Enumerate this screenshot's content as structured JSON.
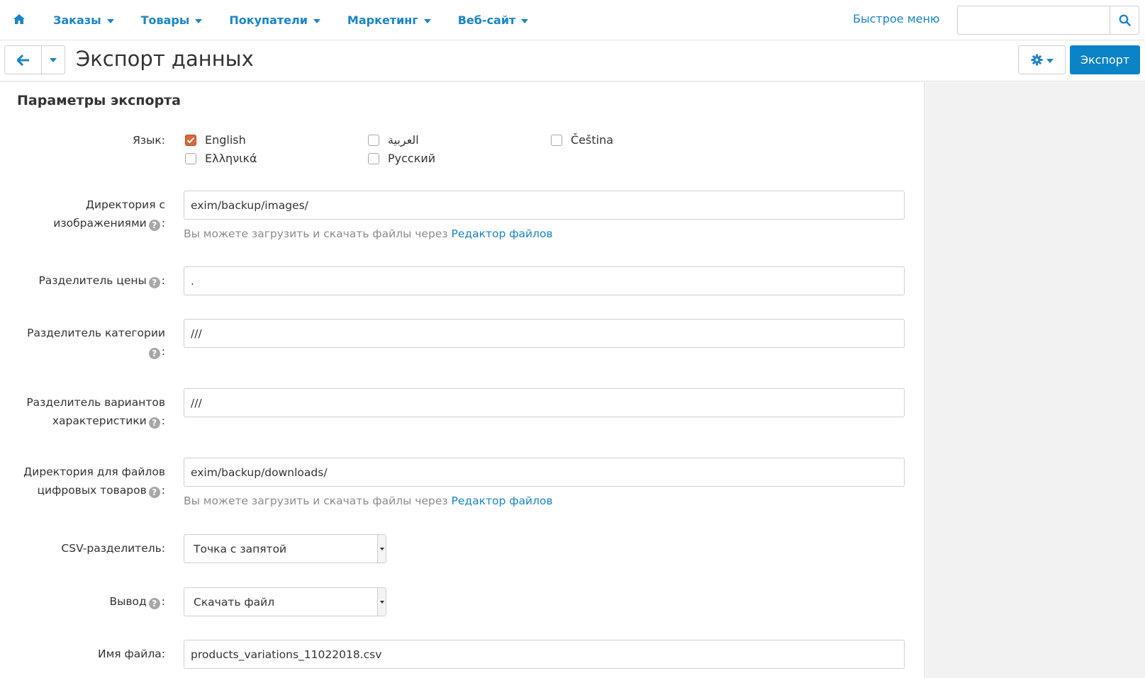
{
  "nav": {
    "items": [
      {
        "label": "Заказы"
      },
      {
        "label": "Товары"
      },
      {
        "label": "Покупатели"
      },
      {
        "label": "Маркетинг"
      },
      {
        "label": "Веб-сайт"
      }
    ],
    "quick_menu": "Быстрое меню",
    "search_value": ""
  },
  "header": {
    "title": "Экспорт данных",
    "export_label": "Экспорт"
  },
  "form": {
    "section_title": "Параметры экспорта",
    "language": {
      "label": "Язык:",
      "options": [
        {
          "label": "English",
          "checked": true
        },
        {
          "label": "العربية",
          "checked": false
        },
        {
          "label": "Čeština",
          "checked": false
        },
        {
          "label": "Ελληνικά",
          "checked": false
        },
        {
          "label": "Русский",
          "checked": false
        }
      ]
    },
    "images_dir": {
      "label_line1": "Директория с",
      "label_line2": "изображениями",
      "value": "exim/backup/images/",
      "hint": "Вы можете загрузить и скачать файлы через",
      "hint_link": "Редактор файлов"
    },
    "price_delim": {
      "label": "Разделитель цены",
      "value": "."
    },
    "category_delim": {
      "label": "Разделитель категории",
      "value": "///"
    },
    "variant_delim": {
      "label_line1": "Разделитель вариантов",
      "label_line2": "характеристики",
      "value": "///"
    },
    "downloads_dir": {
      "label_line1": "Директория для файлов",
      "label_line2": "цифровых товаров",
      "value": "exim/backup/downloads/",
      "hint": "Вы можете загрузить и скачать файлы через",
      "hint_link": "Редактор файлов"
    },
    "csv_delim": {
      "label": "CSV-разделитель:",
      "value": "Точка с запятой"
    },
    "output": {
      "label": "Вывод",
      "value": "Скачать файл"
    },
    "filename": {
      "label": "Имя файла:",
      "value": "products_variations_11022018.csv"
    }
  },
  "colors": {
    "accent": "#1a84c7",
    "primary_button": "#0b83c7",
    "checkbox_checked": "#d9653a"
  }
}
